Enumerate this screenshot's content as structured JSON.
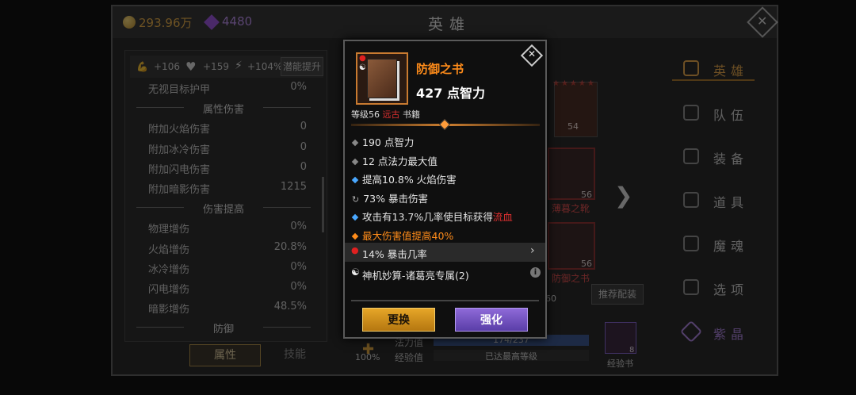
{
  "topbar": {
    "gold": "293.96万",
    "gems": "4480",
    "title": "英雄"
  },
  "boosts": [
    {
      "icon": "strength-icon",
      "value": "+106"
    },
    {
      "icon": "heart-icon",
      "value": "+159"
    },
    {
      "icon": "lightning-icon",
      "value": "+104%"
    }
  ],
  "potential_button": "潜能提升",
  "stats": [
    {
      "label": "无视目标护甲",
      "value": "0%"
    },
    {
      "section": "属性伤害"
    },
    {
      "label": "附加火焰伤害",
      "value": "0"
    },
    {
      "label": "附加冰冷伤害",
      "value": "0"
    },
    {
      "label": "附加闪电伤害",
      "value": "0"
    },
    {
      "label": "附加暗影伤害",
      "value": "1215"
    },
    {
      "section": "伤害提高"
    },
    {
      "label": "物理增伤",
      "value": "0%"
    },
    {
      "label": "火焰增伤",
      "value": "20.8%"
    },
    {
      "label": "冰冷增伤",
      "value": "0%"
    },
    {
      "label": "闪电增伤",
      "value": "0%"
    },
    {
      "label": "暗影增伤",
      "value": "48.5%"
    },
    {
      "section": "防御"
    }
  ],
  "bottom_tabs": {
    "attributes": "属性",
    "skills": "技能"
  },
  "hero": {
    "level_badge": "54",
    "pct": "100%",
    "mana_label": "法力值",
    "mana_value": "174/237",
    "exp_label": "经验值",
    "exp_value": "已达最高等级",
    "exp_book_label": "经验书",
    "exp_book_count": "8"
  },
  "equip": [
    {
      "count": "56",
      "name": "薄暮之靴"
    },
    {
      "count": "56",
      "name": "防御之书"
    },
    {
      "count": "60"
    }
  ],
  "recommend_button": "推荐配装",
  "nav": [
    {
      "icon": "hero-icon",
      "label": "英雄"
    },
    {
      "icon": "flag-icon",
      "label": "队伍"
    },
    {
      "icon": "helmet-icon",
      "label": "装备"
    },
    {
      "icon": "bag-icon",
      "label": "道具"
    },
    {
      "icon": "fire-icon",
      "label": "魔魂"
    },
    {
      "icon": "gear-icon",
      "label": "选项"
    },
    {
      "icon": "crystal-icon",
      "label": "紫晶"
    }
  ],
  "popup": {
    "name": "防御之书",
    "main_stat": "427 点智力",
    "level": "等级56",
    "rarity": "远古",
    "type": "书籍",
    "lines": [
      {
        "text": "190 点智力",
        "marker": "gray"
      },
      {
        "text": "12 点法力最大值",
        "marker": "gray"
      },
      {
        "text": "提高10.8% 火焰伤害",
        "marker": "blue"
      },
      {
        "text": "73% 暴击伤害",
        "marker": "swirl"
      },
      {
        "text": "攻击有13.7%几率使目标获得",
        "extra": "流血",
        "marker": "blue"
      },
      {
        "text": "最大伤害值提高40%",
        "marker": "orange"
      }
    ],
    "socket": "14% 暴击几率",
    "set": "神机妙算-诸葛亮专属(2)",
    "replace_button": "更换",
    "upgrade_button": "强化"
  },
  "colors": {
    "gold": "#e0a030",
    "orange": "#ff8c1a",
    "red": "#e03030",
    "blue": "#4aa8ff",
    "purple": "#7d5ad0"
  }
}
